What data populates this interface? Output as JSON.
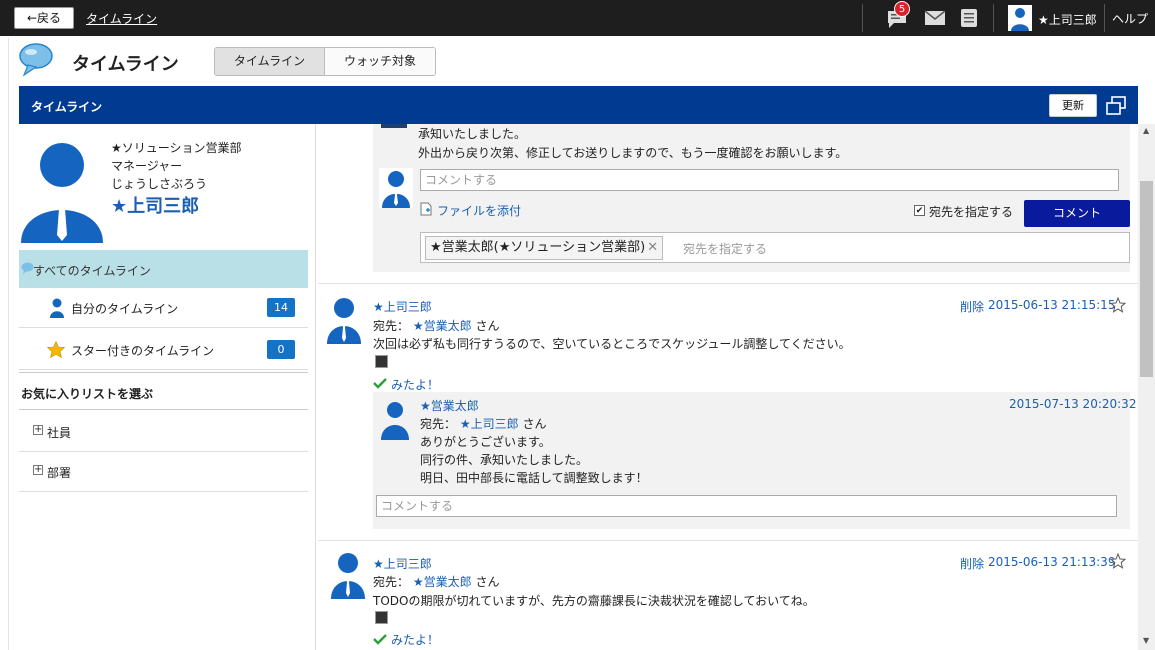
{
  "topbar": {
    "back_label": "←戻る",
    "breadcrumb": "タイムライン",
    "notification_count": "5",
    "user_name": "★上司三郎",
    "help_label": "ヘルプ"
  },
  "header": {
    "app_title": "タイムライン",
    "tabs": [
      {
        "label": "タイムライン",
        "active": true
      },
      {
        "label": "ウォッチ対象",
        "active": false
      }
    ]
  },
  "panel": {
    "title": "タイムライン",
    "refresh_label": "更新"
  },
  "profile": {
    "department": "★ソリューション営業部",
    "position": "マネージャー",
    "reading": "じょうしさぶろう",
    "name": "★上司三郎"
  },
  "sidebar": {
    "all_label": "すべてのタイムライン",
    "items": [
      {
        "label": "自分のタイムライン",
        "count": "14"
      },
      {
        "label": "スター付きのタイムライン",
        "count": "0"
      }
    ],
    "fav_heading": "お気に入りリストを選ぶ",
    "tree": [
      {
        "label": "社員"
      },
      {
        "label": "部署"
      }
    ]
  },
  "feed": {
    "top_fragment": {
      "line1": "承知いたしました。",
      "line2": "外出から戻り次第、修正してお送りしますので、もう一度確認をお願いします。"
    },
    "comment_form": {
      "placeholder": "コメントする",
      "attach_label": "ファイルを添付",
      "specify_label": "宛先を指定する",
      "submit_label": "コメント",
      "tag": "★営業太郎(★ソリューション営業部)",
      "tag_placeholder": "宛先を指定する"
    },
    "posts": [
      {
        "author": "★上司三郎",
        "delete_label": "削除",
        "timestamp": "2015-06-13 21:15:15",
        "to_label": "宛先：",
        "to_name": "★営業太郎",
        "to_suffix": "さん",
        "body": "次回は必ず私も同行すうるので、空いているところでスケッジュール調整してください。",
        "seen_label": "みたよ！",
        "reply": {
          "author": "★営業太郎",
          "timestamp": "2015-07-13 20:20:32",
          "to_label": "宛先：",
          "to_name": "★上司三郎",
          "to_suffix": "さん",
          "line1": "ありがとうございます。",
          "line2": "同行の件、承知いたしました。",
          "line3": "明日、田中部長に電話して調整致します！"
        },
        "comment_placeholder": "コメントする"
      },
      {
        "author": "★上司三郎",
        "delete_label": "削除",
        "timestamp": "2015-06-13 21:13:39",
        "to_label": "宛先：",
        "to_name": "★営業太郎",
        "to_suffix": "さん",
        "body": "TODOの期限が切れていますが、先方の齋藤課長に決裁状況を確認しておいてね。",
        "seen_label": "みたよ！"
      }
    ]
  },
  "colors": {
    "topbar": "#1e1e1e",
    "panel_bar": "#003a91",
    "accent_link": "#1a5fb4",
    "comment_button": "#0a1a9c",
    "badge": "#d9232b",
    "sidebar_active": "#b9e0e6"
  }
}
